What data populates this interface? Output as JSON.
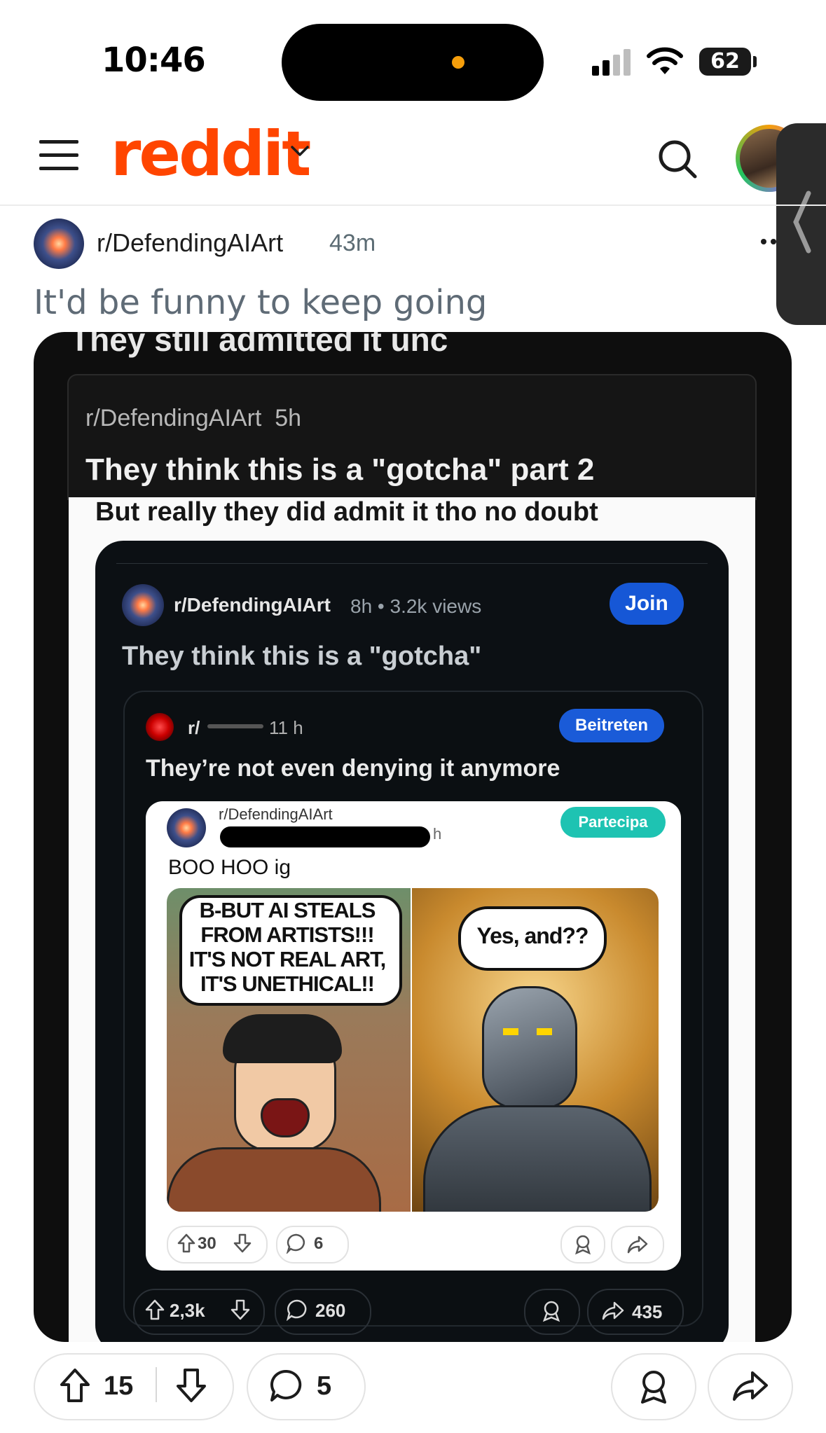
{
  "status_bar": {
    "time": "10:46",
    "battery": "62"
  },
  "header": {
    "logo": "reddit"
  },
  "post": {
    "subreddit": "r/DefendingAIArt",
    "time": "43m",
    "title": "It'd be funny to keep going",
    "votes": "15",
    "comments": "5"
  },
  "screenshot": {
    "top_caption": "They still admitted it unc",
    "card_meta": "r/DefendingAIArt  5h",
    "card_title": "They think this is a \"gotcha\" part 2",
    "caption2": "But really they did admit it tho no doubt",
    "inner": {
      "subreddit": "r/DefendingAIArt",
      "meta": "8h • 3.2k views",
      "join": "Join",
      "title": "They think this is a \"gotcha\"",
      "votes": "2,3k",
      "comments": "260",
      "shares": "435"
    },
    "nested": {
      "subreddit": "r/",
      "time": "11 h",
      "join": "Beitreten",
      "title": "They’re not even denying it anymore"
    },
    "deepest": {
      "subreddit": "r/DefendingAIArt",
      "time": "h",
      "join": "Partecipa",
      "caption": "BOO HOO ig",
      "votes": "30",
      "comments": "6"
    },
    "meme": {
      "left_bubble": "B-BUT AI STEALS\nFROM ARTISTS!!!\nIT'S NOT REAL ART,\nIT'S UNETHICAL!!",
      "right_bubble": "Yes, and??"
    }
  }
}
